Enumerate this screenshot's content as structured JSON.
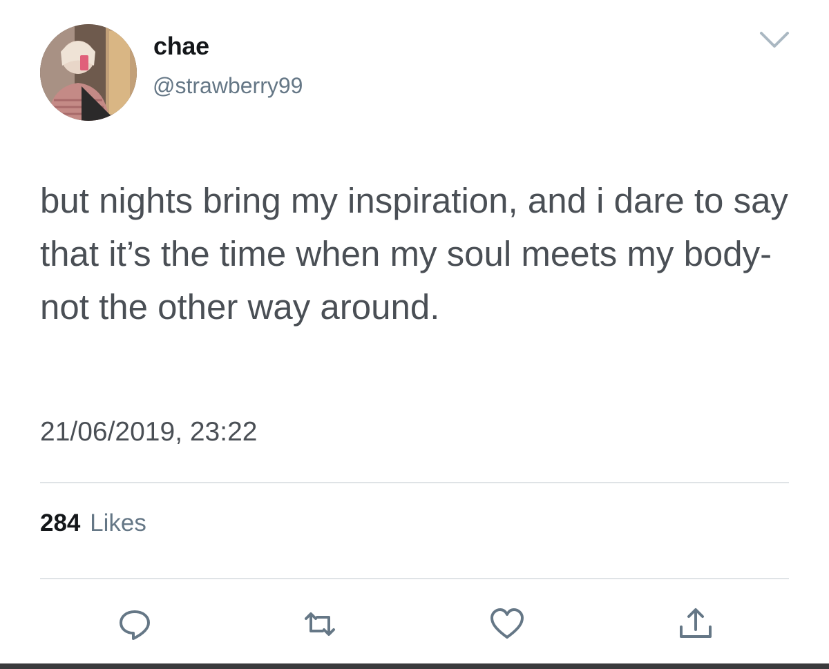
{
  "author": {
    "name": "chae",
    "handle": "@strawberry99",
    "avatar_icon": "profile-photo"
  },
  "tweet": {
    "text": "but nights bring my inspiration, and i dare to say that it’s the time when my soul meets my body- not the other way around.",
    "timestamp": "21/06/2019, 23:22"
  },
  "stats": {
    "likes_count": "284",
    "likes_label": "Likes"
  },
  "actions": [
    {
      "name": "reply",
      "icon": "reply-icon"
    },
    {
      "name": "retweet",
      "icon": "retweet-icon"
    },
    {
      "name": "like",
      "icon": "heart-icon"
    },
    {
      "name": "share",
      "icon": "share-icon"
    }
  ],
  "colors": {
    "text_primary": "#14171a",
    "text_secondary": "#657786",
    "body_text": "#4a4f55",
    "icon": "#657786",
    "divider": "#dfe3e6"
  }
}
